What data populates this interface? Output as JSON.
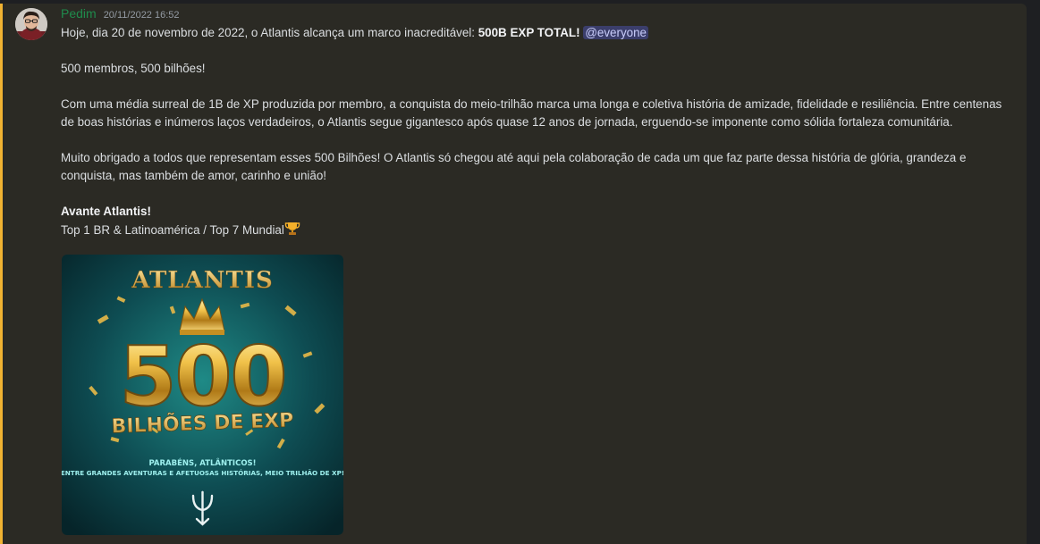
{
  "message": {
    "author": "Pedim",
    "timestamp": "20/11/2022 16:52",
    "line1_prefix": "Hoje, dia 20 de novembro de 2022, o Atlantis alcança um marco inacreditável: ",
    "line1_bold": "500B EXP TOTAL!",
    "mention": "@everyone",
    "para2": "500 membros, 500 bilhões!",
    "para3": "Com uma média surreal de 1B de XP produzida por membro, a conquista do meio-trilhão marca uma longa e coletiva história de amizade, fidelidade e resiliência. Entre centenas de boas histórias e inúmeros laços verdadeiros, o Atlantis segue gigantesco após quase 12 anos de jornada, erguendo-se imponente como sólida fortaleza comunitária.",
    "para4": "Muito obrigado a todos que representam esses 500 Bilhões! O Atlantis só chegou até aqui pela colaboração de cada um que faz parte dessa história de glória, grandeza e conquista, mas também de amor, carinho e união!",
    "signoff_bold": "Avante Atlantis!",
    "ranking": "Top 1 BR & Latinoamérica / Top 7 Mundial"
  },
  "image": {
    "title": "ATLANTIS",
    "number": "500",
    "subtitle": "BILHÕES DE EXP",
    "caption_line1": "PARABÉNS, ATLÂNTICOS!",
    "caption_line2": "ENTRE GRANDES AVENTURAS E AFETUOSAS HISTÓRIAS, MEIO TRILHÃO DE XP!"
  },
  "colors": {
    "accent_highlight": "#f0b232",
    "author_color": "#1f8b4c",
    "mention_bg": "#5865f2"
  },
  "icons": {
    "avatar": "user-avatar",
    "trophy": "trophy-icon",
    "trident": "trident-icon"
  }
}
